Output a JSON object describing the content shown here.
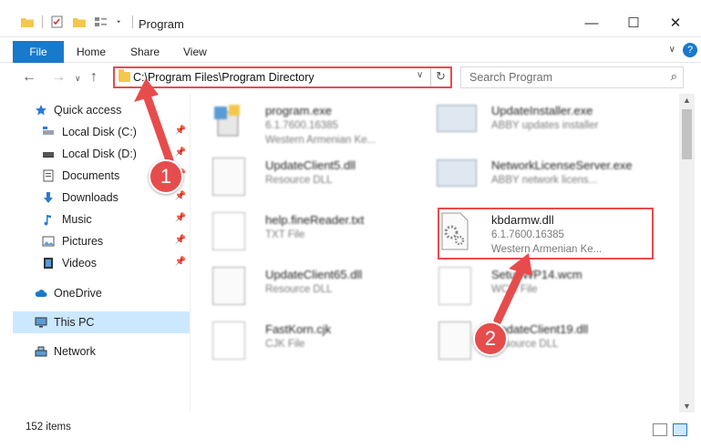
{
  "window": {
    "title": "Program",
    "minimize_glyph": "—",
    "maximize_glyph": "☐",
    "close_glyph": "✕"
  },
  "ribbon": {
    "tabs": [
      "File",
      "Home",
      "Share",
      "View"
    ],
    "expand_glyph": "∨",
    "help_glyph": "?"
  },
  "nav": {
    "back_glyph": "←",
    "forward_glyph": "→",
    "recent_glyph": "∨",
    "up_glyph": "↑",
    "address_path": "C:\\Program Files\\Program Directory",
    "address_dropdown_glyph": "∨",
    "refresh_glyph": "↻",
    "search_placeholder": "Search Program",
    "search_glyph": "⌕"
  },
  "sidebar": {
    "items": [
      {
        "label": "Quick access",
        "icon": "star-icon",
        "pinned": false
      },
      {
        "label": "Local Disk (C:)",
        "icon": "drive-icon",
        "pinned": true
      },
      {
        "label": "Local Disk (D:)",
        "icon": "drive-icon",
        "pinned": true
      },
      {
        "label": "Documents",
        "icon": "documents-icon",
        "pinned": true
      },
      {
        "label": "Downloads",
        "icon": "download-icon",
        "pinned": true
      },
      {
        "label": "Music",
        "icon": "music-icon",
        "pinned": true
      },
      {
        "label": "Pictures",
        "icon": "pictures-icon",
        "pinned": true
      },
      {
        "label": "Videos",
        "icon": "videos-icon",
        "pinned": true
      },
      {
        "label": "OneDrive",
        "icon": "cloud-icon",
        "pinned": false
      },
      {
        "label": "This PC",
        "icon": "pc-icon",
        "pinned": false,
        "selected": true
      },
      {
        "label": "Network",
        "icon": "network-icon",
        "pinned": false
      }
    ],
    "pin_glyph": "📌"
  },
  "files": [
    {
      "name": "program.exe",
      "line2": "6.1.7600.16385",
      "line3": "Western Armenian Ke...",
      "icon": "installer-icon"
    },
    {
      "name": "UpdateInstaller.exe",
      "line2": "ABBY updates installer",
      "line3": "",
      "icon": "window-icon"
    },
    {
      "name": "UpdateClient5.dll",
      "line2": "Resource DLL",
      "line3": "",
      "icon": "gear-file-icon"
    },
    {
      "name": "NetworkLicenseServer.exe",
      "line2": "ABBY network licens...",
      "line3": "",
      "icon": "window-icon"
    },
    {
      "name": "help.fineReader.txt",
      "line2": "TXT File",
      "line3": "",
      "icon": "text-file-icon"
    },
    {
      "name": "kbdarmw.dll",
      "line2": "6.1.7600.16385",
      "line3": "Western Armenian Ke...",
      "icon": "gear-file-icon"
    },
    {
      "name": "UpdateClient65.dll",
      "line2": "Resource DLL",
      "line3": "",
      "icon": "gear-file-icon"
    },
    {
      "name": "SetupWP14.wcm",
      "line2": "WCM File",
      "line3": "",
      "icon": "blank-file-icon"
    },
    {
      "name": "FastKorn.cjk",
      "line2": "CJK File",
      "line3": "",
      "icon": "blank-file-icon"
    },
    {
      "name": "UpdateClient19.dll",
      "line2": "Resource DLL",
      "line3": "",
      "icon": "gear-file-icon"
    }
  ],
  "status": {
    "item_count": "152 items"
  },
  "callouts": [
    "1",
    "2"
  ],
  "colors": {
    "accent": "#1979ca",
    "highlight": "#e74c4c",
    "selected": "#cce8ff"
  }
}
